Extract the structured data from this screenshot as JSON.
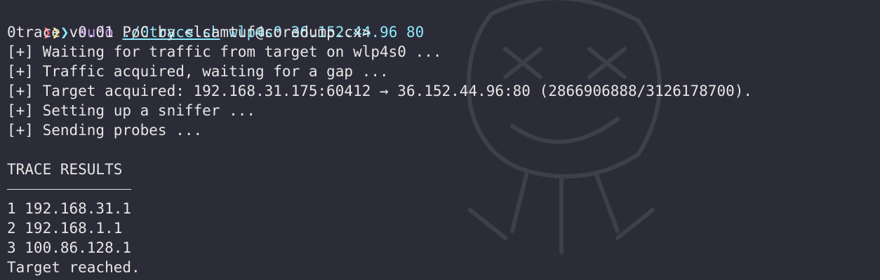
{
  "prompt": {
    "arrows": [
      "❯",
      "❯",
      "❯"
    ],
    "command": "sudo",
    "script": "./0trace.sh",
    "args": "wlp4s0 36.152.44.96 80"
  },
  "output": [
    "0trace v0.01 PoC by <lcamtuf@coredump.cx>",
    "[+] Waiting for traffic from target on wlp4s0 ...",
    "[+] Traffic acquired, waiting for a gap ...",
    "[+] Target acquired: 192.168.31.175:60412 → 36.152.44.96:80 (2866906888/3126178700).",
    "[+] Setting up a sniffer ...",
    "[+] Sending probes ..."
  ],
  "results": {
    "heading": "TRACE RESULTS",
    "hops": [
      "1 192.168.31.1",
      "2 192.168.1.1",
      "3 100.86.128.1"
    ],
    "final": "Target reached."
  },
  "colors": {
    "background": "#2b2c37",
    "text": "#e6e6e6",
    "arrow_red": "#ff5f6d",
    "arrow_yellow": "#ffd866",
    "arrow_cyan": "#8be9fd",
    "sudo": "#c792ea",
    "path": "#8be9fd"
  }
}
